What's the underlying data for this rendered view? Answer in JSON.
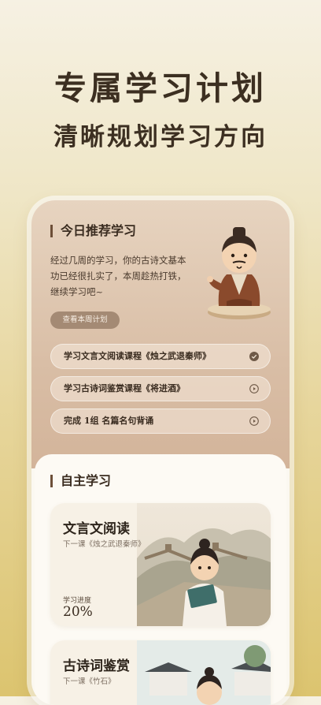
{
  "hero": {
    "title": "专属学习计划",
    "subtitle": "清晰规划学习方向"
  },
  "today": {
    "section_title": "今日推荐学习",
    "description": "经过几周的学习，你的古诗文基本功已经很扎实了，本周趁热打铁，继续学习吧~",
    "plan_button": "查看本周计划",
    "tasks": [
      {
        "label": "学习文言文阅读课程《烛之武退秦师》",
        "icon": "check-circle-icon",
        "status": "completed"
      },
      {
        "label": "学习古诗词鉴赏课程《将进酒》",
        "icon": "play-circle-icon",
        "status": "pending"
      },
      {
        "label": "完成 1组 名篇名句背诵",
        "icon": "play-circle-icon",
        "status": "pending"
      }
    ]
  },
  "self_study": {
    "section_title": "自主学习",
    "courses": [
      {
        "title": "文言文阅读",
        "next": "下一课《烛之武退秦师》",
        "progress_label": "学习进度",
        "progress": "20%"
      },
      {
        "title": "古诗词鉴赏",
        "next": "下一课《竹石》"
      }
    ]
  },
  "colors": {
    "accent": "#6d4f38",
    "button": "#a48a74",
    "background_top": "#f6f1e3",
    "background_bottom": "#dcc46f"
  }
}
